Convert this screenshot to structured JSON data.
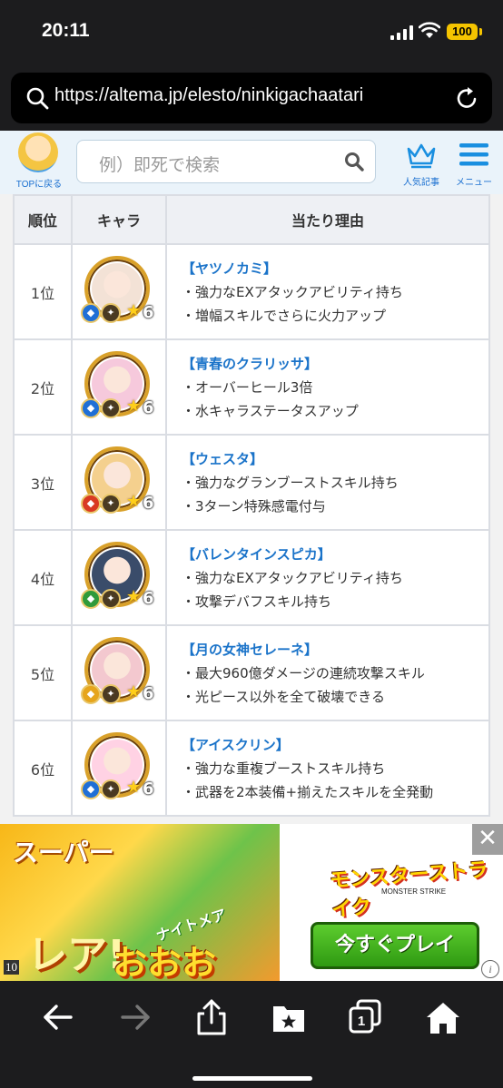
{
  "status": {
    "time": "20:11",
    "battery": "100"
  },
  "browser": {
    "url": "https://altema.jp/elesto/ninkigachaatari"
  },
  "site": {
    "top_label": "TOPに戻る",
    "search_placeholder": "例）即死で検索",
    "popular_label": "人気記事",
    "menu_label": "メニュー"
  },
  "table": {
    "headers": [
      "順位",
      "キャラ",
      "当たり理由"
    ],
    "rows": [
      {
        "rank": "1位",
        "name": "【ヤツノカミ】",
        "reasons": [
          "・強力なEXアタックアビリティ持ち",
          "・増幅スキルでさらに火力アップ"
        ],
        "stars": "6",
        "element_color": "#1f6fd6",
        "element_icon": "water-element-icon",
        "face_color": "#f3e2d6"
      },
      {
        "rank": "2位",
        "name": "【青春のクラリッサ】",
        "reasons": [
          "・オーバーヒール3倍",
          "・水キャラステータスアップ"
        ],
        "stars": "6",
        "element_color": "#1f6fd6",
        "element_icon": "water-element-icon",
        "face_color": "#f6c9dc"
      },
      {
        "rank": "3位",
        "name": "【ウェスタ】",
        "reasons": [
          "・強力なグランブーストスキル持ち",
          "・3ターン特殊感電付与"
        ],
        "stars": "6",
        "element_color": "#d93a22",
        "element_icon": "fire-element-icon",
        "face_color": "#f4d08e"
      },
      {
        "rank": "4位",
        "name": "【バレンタインスピカ】",
        "reasons": [
          "・強力なEXアタックアビリティ持ち",
          "・攻撃デバフスキル持ち"
        ],
        "stars": "6",
        "element_color": "#2f9a3a",
        "element_icon": "wind-element-icon",
        "face_color": "#3a4c6a"
      },
      {
        "rank": "5位",
        "name": "【月の女神セレーネ】",
        "reasons": [
          "・最大960億ダメージの連続攻撃スキル",
          "・光ピース以外を全て破壊できる"
        ],
        "stars": "6",
        "element_color": "#e6a51c",
        "element_icon": "light-element-icon",
        "face_color": "#f3c8cf"
      },
      {
        "rank": "6位",
        "name": "【アイスクリン】",
        "reasons": [
          "・強力な重複ブーストスキル持ち",
          "・武器を2本装備+揃えたスキルを全発動"
        ],
        "stars": "6",
        "element_color": "#1f6fd6",
        "element_icon": "water-element-icon",
        "face_color": "#ffd2e4"
      }
    ]
  },
  "ad": {
    "super": "スーパー",
    "rare": "レア!",
    "nightmare": "ナイトメア",
    "oooo": "おおおお!!",
    "number": "10",
    "logo": "モンスターストライク",
    "logo_sub": "MONSTER STRIKE",
    "play": "今すぐプレイ"
  },
  "toolbar": {
    "tab_count": "1"
  }
}
